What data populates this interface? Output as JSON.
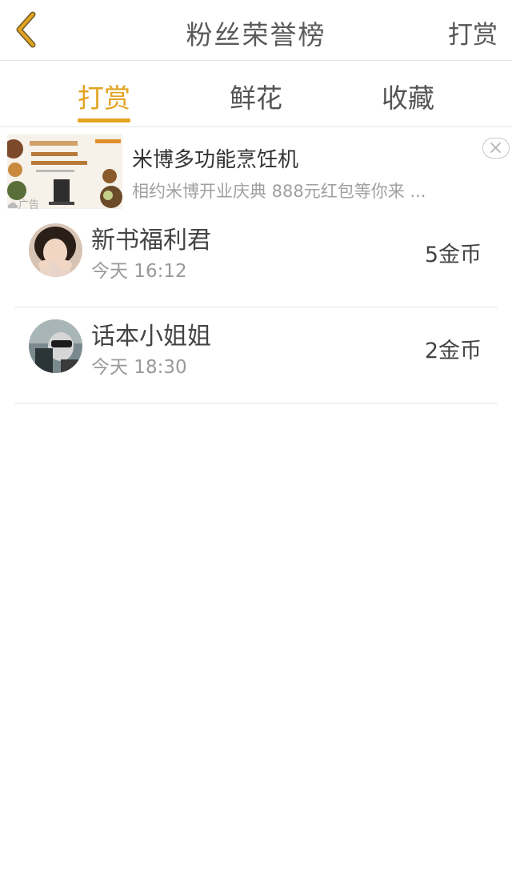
{
  "header": {
    "title": "粉丝荣誉榜",
    "reward_label": "打赏"
  },
  "tabs": [
    {
      "label": "打赏",
      "active": true
    },
    {
      "label": "鲜花",
      "active": false
    },
    {
      "label": "收藏",
      "active": false
    }
  ],
  "ad": {
    "title": "米博多功能烹饪机",
    "description": "相约米博开业庆典 888元红包等你来 ...",
    "label": "广告"
  },
  "list": [
    {
      "name": "新书福利君",
      "time": "今天 16:12",
      "coins": "5金币"
    },
    {
      "name": "话本小姐姐",
      "time": "今天 18:30",
      "coins": "2金币"
    }
  ],
  "colors": {
    "accent": "#e2a31f",
    "back_icon": "#e2a31f",
    "text_primary": "#444444",
    "text_secondary": "#999999"
  }
}
